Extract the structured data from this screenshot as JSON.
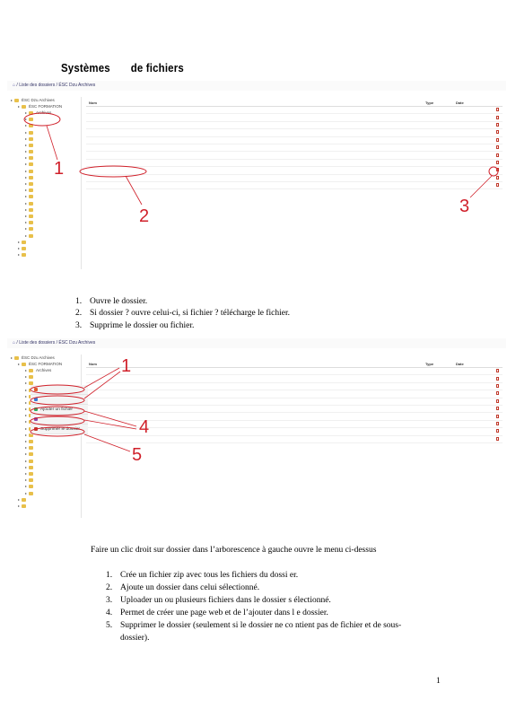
{
  "doc": {
    "title_word1": "Systèmes",
    "title_word2": "de  fichiers",
    "page_number": "1"
  },
  "shot1": {
    "breadcrumb_home": "⌂",
    "breadcrumb_path": "/ Liste des dossiers  /  ÉSC Dzu Archives",
    "tree": [
      {
        "label": "ÉSC Dzu Archives",
        "level": 0
      },
      {
        "label": "ÉSC FORMATION",
        "level": 1
      },
      {
        "label": "Archives",
        "level": 2
      },
      {
        "label": "",
        "level": 2
      },
      {
        "label": "",
        "level": 2
      },
      {
        "label": "",
        "level": 2
      },
      {
        "label": "",
        "level": 2
      },
      {
        "label": "",
        "level": 2
      },
      {
        "label": "",
        "level": 2
      },
      {
        "label": "",
        "level": 2
      },
      {
        "label": "",
        "level": 2
      },
      {
        "label": "",
        "level": 2
      },
      {
        "label": "",
        "level": 2
      },
      {
        "label": "",
        "level": 2
      },
      {
        "label": "",
        "level": 2
      },
      {
        "label": "",
        "level": 2
      },
      {
        "label": "",
        "level": 2
      },
      {
        "label": "",
        "level": 2
      },
      {
        "label": "",
        "level": 2
      },
      {
        "label": "",
        "level": 2
      },
      {
        "label": "",
        "level": 2
      },
      {
        "label": "",
        "level": 2
      },
      {
        "label": "",
        "level": 1
      },
      {
        "label": "",
        "level": 1
      },
      {
        "label": "",
        "level": 1
      }
    ],
    "columns": {
      "name": "Nom",
      "type": "Type",
      "date": "Date"
    },
    "rows": [
      {
        "name": "",
        "type": "",
        "date": ""
      },
      {
        "name": "",
        "type": "",
        "date": ""
      },
      {
        "name": "",
        "type": "",
        "date": ""
      },
      {
        "name": "",
        "type": "",
        "date": ""
      },
      {
        "name": "",
        "type": "",
        "date": ""
      },
      {
        "name": "",
        "type": "",
        "date": ""
      },
      {
        "name": "",
        "type": "",
        "date": ""
      },
      {
        "name": "",
        "type": "",
        "date": ""
      },
      {
        "name": "",
        "type": "",
        "date": ""
      },
      {
        "name": "",
        "type": "",
        "date": ""
      },
      {
        "name": "",
        "type": "",
        "date": ""
      }
    ],
    "callouts": [
      "1",
      "2",
      "3"
    ]
  },
  "list1": [
    {
      "num": "1.",
      "text": "Ouvre le dossier."
    },
    {
      "num": "2.",
      "text": "Si dossier ?  ouvre celui-ci, si fichier  ?  télécharge le fichier."
    },
    {
      "num": "3.",
      "text": "Supprime le dossier ou fichier."
    }
  ],
  "shot2": {
    "breadcrumb_home": "⌂",
    "breadcrumb_path": "/ Liste des dossiers  /  ÉSC Dzu Archives",
    "columns": {
      "name": "Nom",
      "type": "Type",
      "date": "Date"
    },
    "rows": [
      {
        "name": "",
        "type": "",
        "date": ""
      },
      {
        "name": "",
        "type": "",
        "date": ""
      },
      {
        "name": "",
        "type": "",
        "date": ""
      },
      {
        "name": "",
        "type": "",
        "date": ""
      },
      {
        "name": "",
        "type": "",
        "date": ""
      },
      {
        "name": "",
        "type": "",
        "date": ""
      },
      {
        "name": "",
        "type": "",
        "date": ""
      },
      {
        "name": "",
        "type": "",
        "date": ""
      },
      {
        "name": "",
        "type": "",
        "date": ""
      },
      {
        "name": "",
        "type": "",
        "date": ""
      }
    ],
    "context_menu": [
      {
        "label": "",
        "color": "#e05a2b"
      },
      {
        "label": "",
        "color": "#3a7bd5"
      },
      {
        "label": "Ajouter un fichier",
        "color": "#27ae60"
      },
      {
        "label": "",
        "color": "#8e44ad"
      },
      {
        "label": "Supprimer le dossier",
        "color": "#c0392b"
      }
    ],
    "callouts": [
      "1",
      "4",
      "5"
    ]
  },
  "intro2": "Faire un clic droit sur dossier dans l’arborescence     à gauche ouvre le menu ci-dessus",
  "list2": [
    {
      "num": "1.",
      "text": "Crée un fichier zip avec tous les fichiers du dossi    er."
    },
    {
      "num": "2.",
      "text": "Ajoute un dossier dans celui sélectionné."
    },
    {
      "num": "3.",
      "text": "Uploader un ou plusieurs fichiers dans le dossier s      électionné."
    },
    {
      "num": "4.",
      "text": "Permet de créer une page web et de l’ajouter dans l      e dossier."
    },
    {
      "num": "5.",
      "text": "Supprimer le dossier (seulement si le dossier ne co      ntient pas de fichier et de sous-"
    },
    {
      "num": "",
      "text": "dossier)."
    }
  ],
  "colors": {
    "annotation": "#d0202a",
    "folder": "#e8c04a",
    "delete": "#c0392b"
  }
}
